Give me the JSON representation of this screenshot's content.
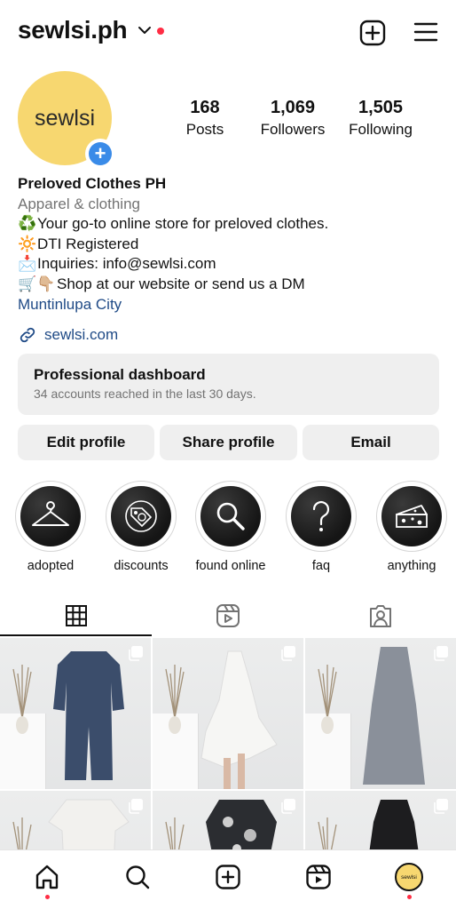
{
  "header": {
    "username": "sewlsi.ph",
    "icons": [
      "chevron-down-icon",
      "notification-dot",
      "create-post-icon",
      "menu-icon"
    ]
  },
  "profile": {
    "avatar_text": "sewlsi",
    "stats": [
      {
        "value": "168",
        "label": "Posts"
      },
      {
        "value": "1,069",
        "label": "Followers"
      },
      {
        "value": "1,505",
        "label": "Following"
      }
    ],
    "name": "Preloved Clothes PH",
    "category": "Apparel & clothing",
    "bio_lines": [
      {
        "emoji": "♻️",
        "text": "Your go-to online store for preloved clothes."
      },
      {
        "emoji": "🔆",
        "text": "DTI Registered"
      },
      {
        "emoji": "📩",
        "text": "Inquiries: info@sewlsi.com"
      },
      {
        "emoji": "🛒👇🏼",
        "text": "Shop at our website or send us a DM"
      }
    ],
    "location": "Muntinlupa City",
    "link": "sewlsi.com"
  },
  "dashboard": {
    "title": "Professional dashboard",
    "subtitle": "34 accounts reached in the last 30 days."
  },
  "actions": {
    "edit": "Edit profile",
    "share": "Share profile",
    "email": "Email"
  },
  "highlights": [
    {
      "label": "adopted",
      "icon": "hanger-icon"
    },
    {
      "label": "discounts",
      "icon": "price-tag-icon"
    },
    {
      "label": "found online",
      "icon": "magnifier-icon"
    },
    {
      "label": "faq",
      "icon": "question-icon"
    },
    {
      "label": "anything",
      "icon": "cheese-icon"
    }
  ],
  "tabs": [
    {
      "name": "grid",
      "icon": "grid-icon",
      "active": true
    },
    {
      "name": "reels",
      "icon": "reels-icon",
      "active": false
    },
    {
      "name": "tagged",
      "icon": "tagged-icon",
      "active": false
    }
  ],
  "posts": [
    {
      "garment": "navy denim jumpsuit",
      "color": "#3b4d6b"
    },
    {
      "garment": "white ruffled dress",
      "color": "#f4f4f2"
    },
    {
      "garment": "grey knit dress",
      "color": "#8a909a"
    },
    {
      "garment": "white top",
      "color": "#f2f1ee"
    },
    {
      "garment": "floral black dress",
      "color": "#2b2d31"
    },
    {
      "garment": "black dress",
      "color": "#1d1d1f"
    }
  ],
  "bottom_nav": [
    "home-icon",
    "search-icon",
    "create-icon",
    "reels-icon",
    "profile-avatar"
  ],
  "colors": {
    "accent": "#3a8be8",
    "link": "#1f4a86",
    "avatar_bg": "#f7d770",
    "badge_red": "#ff2d44"
  }
}
